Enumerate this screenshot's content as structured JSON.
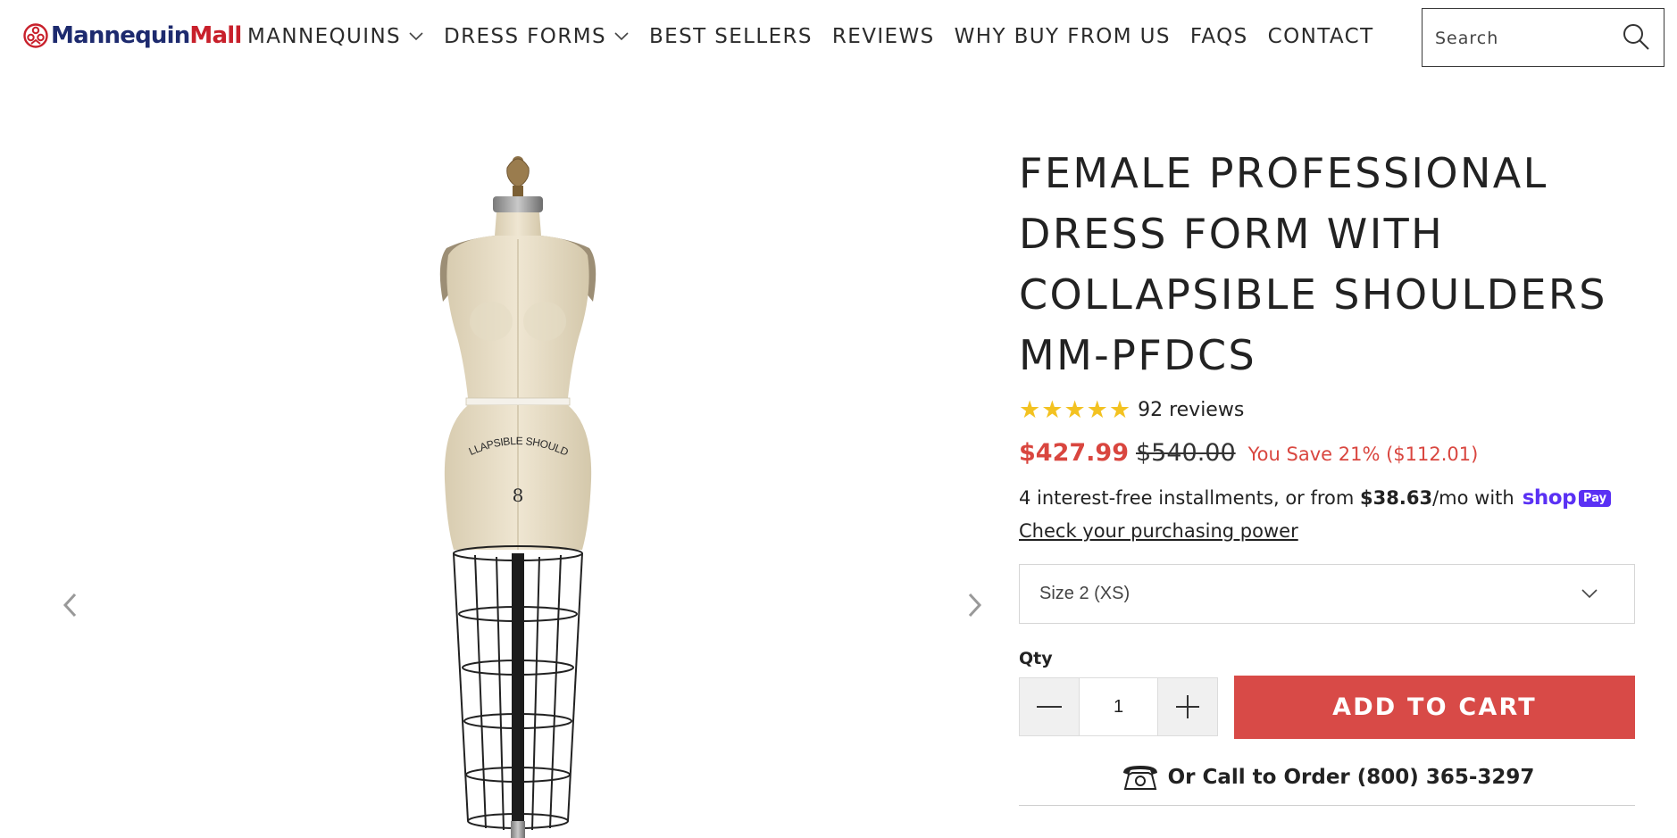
{
  "header": {
    "logo": {
      "part1": "Mannequin",
      "part2": "Mall"
    },
    "nav": [
      {
        "label": "MANNEQUINS",
        "has_dropdown": true
      },
      {
        "label": "DRESS FORMS",
        "has_dropdown": true
      },
      {
        "label": "BEST SELLERS",
        "has_dropdown": false
      },
      {
        "label": "REVIEWS",
        "has_dropdown": false
      },
      {
        "label": "WHY BUY FROM US",
        "has_dropdown": false
      },
      {
        "label": "FAQS",
        "has_dropdown": false
      },
      {
        "label": "CONTACT",
        "has_dropdown": false
      }
    ],
    "search": {
      "placeholder": "Search",
      "icon": "search-icon"
    }
  },
  "gallery": {
    "form_text": "COLLAPSIBLE SHOULDER",
    "form_size": "8",
    "icons": {
      "prev": "chevron-left-icon",
      "next": "chevron-right-icon"
    }
  },
  "product": {
    "title": "FEMALE PROFESSIONAL DRESS FORM WITH COLLAPSIBLE SHOULDERS MM-PFDCS",
    "rating": {
      "stars": 5,
      "reviews_label": "92 reviews"
    },
    "price": {
      "current": "$427.99",
      "original": "$540.00",
      "savings": "You Save 21% ($112.01)"
    },
    "installments": {
      "prefix": "4 interest-free installments, or from",
      "amount": "$38.63",
      "suffix": "/mo with",
      "shop_word": "shop",
      "pay_badge": "Pay",
      "link": "Check your purchasing power"
    },
    "size_select": {
      "value": "Size 2 (XS)"
    },
    "qty": {
      "label": "Qty",
      "value": "1"
    },
    "add_to_cart": "ADD TO CART",
    "call_to_order": "Or Call to Order (800) 365-3297"
  },
  "colors": {
    "accent_red": "#d84a47",
    "price_red": "#d9463f",
    "star_gold": "#f3c221",
    "shop_pay_purple": "#5a31f4",
    "logo_navy": "#1d2a6e",
    "logo_red": "#c8202b"
  }
}
